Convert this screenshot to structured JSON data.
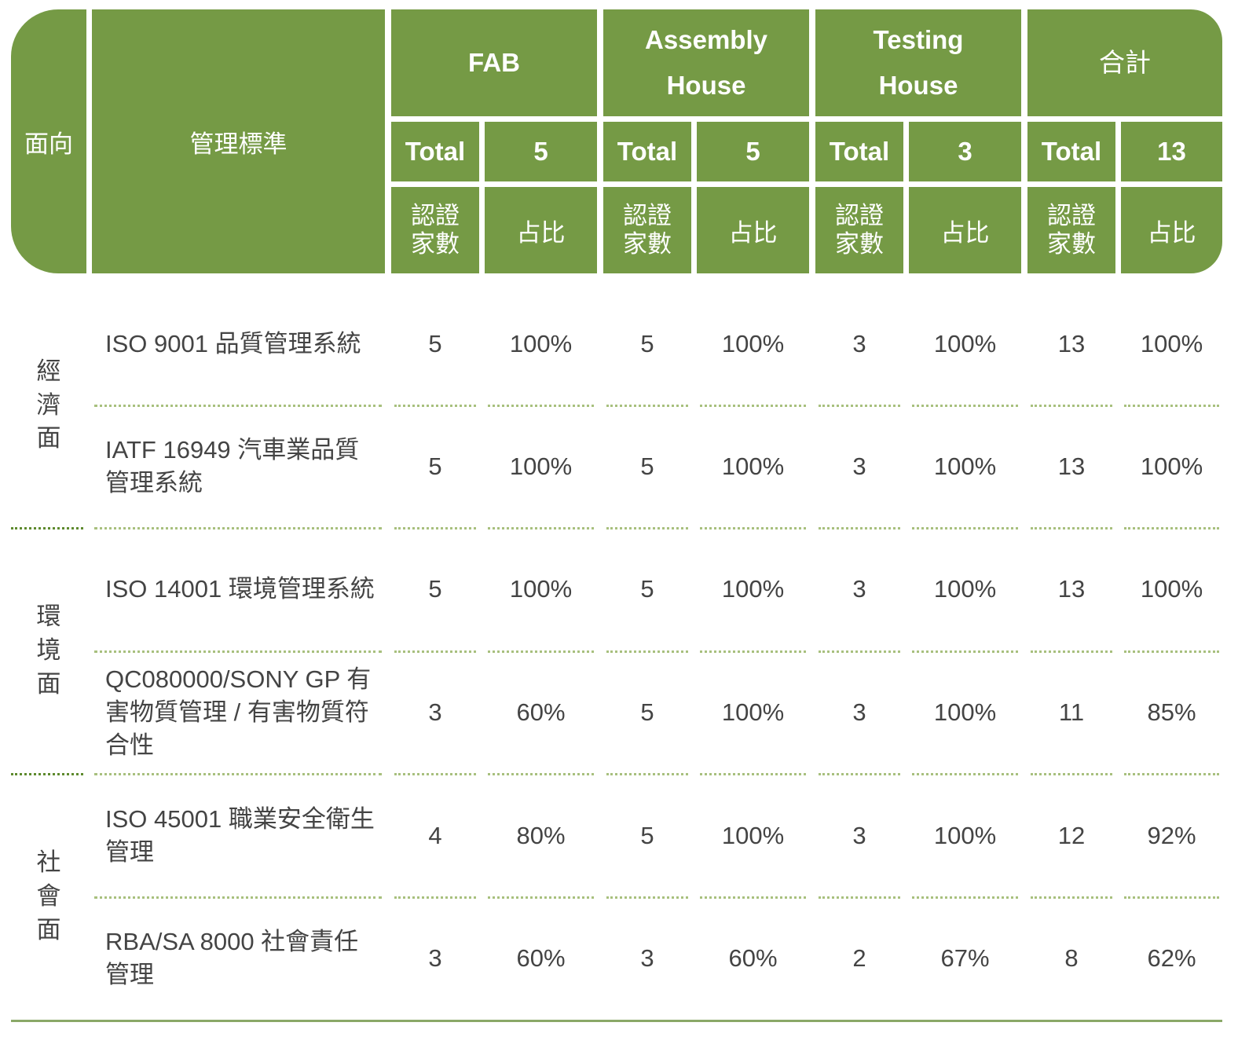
{
  "header": {
    "dimension": "面向",
    "standard": "管理標準",
    "groups": [
      {
        "name": "FAB",
        "total_label": "Total",
        "total_value": "5",
        "count_label": "認證家數",
        "ratio_label": "占比"
      },
      {
        "name": "Assembly House",
        "total_label": "Total",
        "total_value": "5",
        "count_label": "認證家數",
        "ratio_label": "占比"
      },
      {
        "name": "Testing House",
        "total_label": "Total",
        "total_value": "3",
        "count_label": "認證家數",
        "ratio_label": "占比"
      },
      {
        "name": "合計",
        "total_label": "Total",
        "total_value": "13",
        "count_label": "認證家數",
        "ratio_label": "占比"
      }
    ]
  },
  "aspects": [
    {
      "label": "經濟面"
    },
    {
      "label": "環境面"
    },
    {
      "label": "社會面"
    }
  ],
  "rows": [
    {
      "standard": "ISO 9001 品質管理系統",
      "values": [
        "5",
        "100%",
        "5",
        "100%",
        "3",
        "100%",
        "13",
        "100%"
      ]
    },
    {
      "standard": "IATF 16949 汽車業品質管理系統",
      "values": [
        "5",
        "100%",
        "5",
        "100%",
        "3",
        "100%",
        "13",
        "100%"
      ]
    },
    {
      "standard": "ISO 14001 環境管理系統",
      "values": [
        "5",
        "100%",
        "5",
        "100%",
        "3",
        "100%",
        "13",
        "100%"
      ]
    },
    {
      "standard": "QC080000/SONY GP 有害物質管理 / 有害物質符合性",
      "values": [
        "3",
        "60%",
        "5",
        "100%",
        "3",
        "100%",
        "11",
        "85%"
      ]
    },
    {
      "standard": "ISO 45001 職業安全衛生管理",
      "values": [
        "4",
        "80%",
        "5",
        "100%",
        "3",
        "100%",
        "12",
        "92%"
      ]
    },
    {
      "standard": "RBA/SA 8000 社會責任管理",
      "values": [
        "3",
        "60%",
        "3",
        "60%",
        "2",
        "67%",
        "8",
        "62%"
      ]
    }
  ],
  "colors": {
    "header_bg": "#759a45",
    "header_text": "#ffffff",
    "body_text": "#444444",
    "divider": "#a8c07e"
  }
}
